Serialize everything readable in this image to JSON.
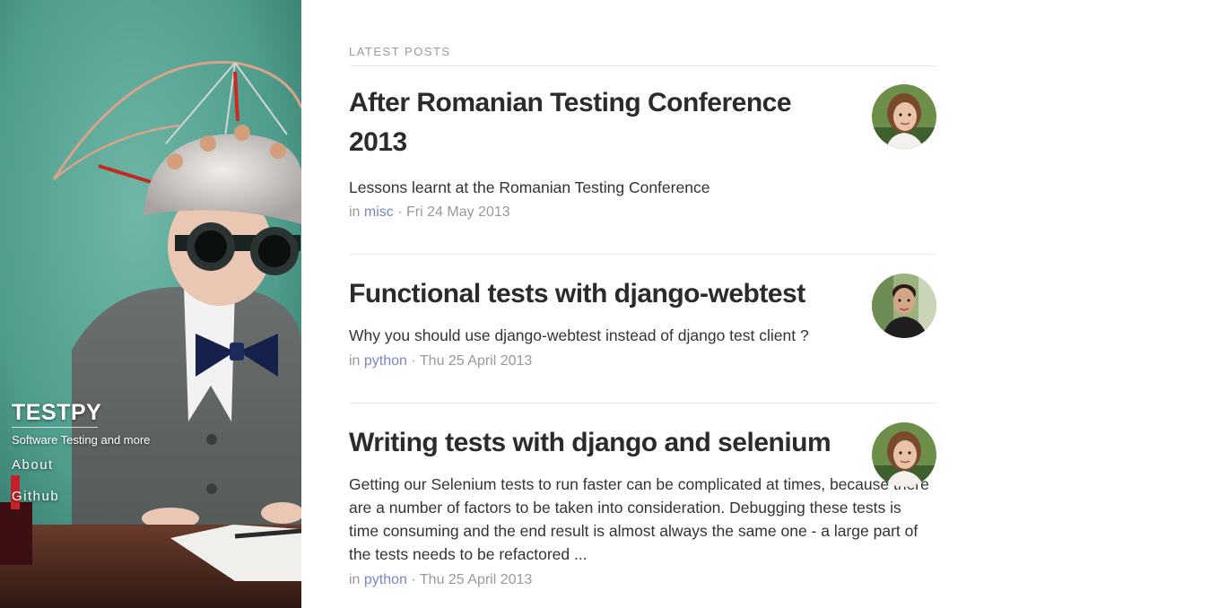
{
  "site": {
    "title": "TESTPY",
    "tagline": "Software Testing and more",
    "nav": [
      {
        "label": "About"
      },
      {
        "label": "Github"
      }
    ]
  },
  "main": {
    "heading": "LATEST POSTS",
    "posts": [
      {
        "title": "After Romanian Testing Conference 2013",
        "summary": "Lessons learnt at the Romanian Testing Conference",
        "in_label": "in",
        "category": "misc",
        "separator": "·",
        "date": "Fri 24 May 2013",
        "avatar": "author-avatar-woman"
      },
      {
        "title": "Functional tests with django-webtest",
        "summary": "Why you should use django-webtest instead of django test client ?",
        "in_label": "in",
        "category": "python",
        "separator": "·",
        "date": "Thu 25 April 2013",
        "avatar": "author-avatar-man"
      },
      {
        "title": "Writing tests with django and selenium",
        "summary": "Getting our Selenium tests to run faster can be complicated at times, because there are a number of factors to be taken into consideration. Debugging these tests is time consuming and the end result is almost always the same one - a large part of the tests needs to be refactored ...",
        "in_label": "in",
        "category": "python",
        "separator": "·",
        "date": "Thu 25 April 2013",
        "avatar": "author-avatar-woman"
      }
    ]
  },
  "colors": {
    "sidebar_teal": "#4e9c8c",
    "link": "#7b86c4",
    "title": "#2b2b2b",
    "meta": "#999999"
  }
}
